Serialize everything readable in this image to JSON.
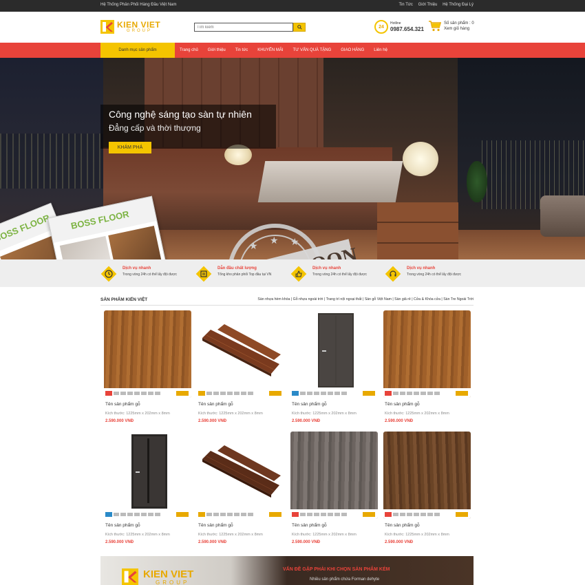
{
  "topbar": {
    "tagline": "Hệ Thống Phân Phối Hàng Đầu Việt Nam",
    "links": [
      "Tin Tức",
      "Giới Thiệu",
      "Hệ Thống Đại Lý"
    ]
  },
  "header": {
    "logo_text": "KIEN VIET",
    "logo_sub": "GROUP",
    "search_placeholder": "Tìm kiếm",
    "hotline_badge": "24",
    "hotline_label": "Hotline",
    "hotline_number": "0987.654.321",
    "cart_count": "Số sản phẩm : 0",
    "cart_view": "Xem giỏ hàng"
  },
  "nav": {
    "category": "Danh mục sản phẩm",
    "items": [
      "Trang chủ",
      "Giới thiệu",
      "Tin tức",
      "KHUYẾN MÃI",
      "TƯ VẤN QUÀ TẶNG",
      "GIAO HÀNG",
      "Liên hệ"
    ]
  },
  "banner": {
    "title": "Công nghệ sáng tạo sàn tự nhiên",
    "subtitle": "Đẳng cấp và thời thượng",
    "button": "KHÁM PHÁ",
    "catalog_brand": "BOSS FLOOR",
    "stamp_text": "COMING SOON"
  },
  "services": [
    {
      "title": "Dịch vụ nhanh",
      "desc": "Trong vòng 24h có thể lấy đội được"
    },
    {
      "title": "Dẫn đầu chất lượng",
      "desc": "Tổng kho phân phối Top đầu tại VN"
    },
    {
      "title": "Dịch vụ nhanh",
      "desc": "Trong vòng 24h có thể lấy đội được"
    },
    {
      "title": "Dịch vụ nhanh",
      "desc": "Trong vòng 24h có thể lấy đội được"
    }
  ],
  "products_section": {
    "title": "SẢN PHẨM KIẾN VIỆT",
    "tabs": "Sàn nhựa hèm khóa | Gỗ nhựa ngoài trời | Trang trí nội ngoại thất | Sàn gỗ Việt Nam | Sàn giả rẻ | Cửa & Khóa cửa | Sàn Tre Ngoài Trời"
  },
  "products": [
    {
      "name": "Tên sản phẩm gỗ",
      "size": "Kích thước: 1225mm x 202mm x 8mm",
      "price": "2.590.000 VNĐ"
    },
    {
      "name": "Tên sản phẩm gỗ",
      "size": "Kích thước: 1225mm x 202mm x 8mm",
      "price": "2.590.000 VNĐ"
    },
    {
      "name": "Tên sản phẩm gỗ",
      "size": "Kích thước: 1225mm x 202mm x 8mm",
      "price": "2.590.000 VNĐ"
    },
    {
      "name": "Tên sản phẩm gỗ",
      "size": "Kích thước: 1225mm x 202mm x 8mm",
      "price": "2.590.000 VNĐ"
    },
    {
      "name": "Tên sản phẩm gỗ",
      "size": "Kích thước: 1225mm x 202mm x 8mm",
      "price": "2.590.000 VNĐ"
    },
    {
      "name": "Tên sản phẩm gỗ",
      "size": "Kích thước: 1225mm x 202mm x 8mm",
      "price": "2.590.000 VNĐ"
    },
    {
      "name": "Tên sản phẩm gỗ",
      "size": "Kích thước: 1225mm x 202mm x 8mm",
      "price": "2.590.000 VNĐ"
    },
    {
      "name": "Tên sản phẩm gỗ",
      "size": "Kích thước: 1225mm x 202mm x 8mm",
      "price": "2.590.000 VNĐ"
    }
  ],
  "bottom_banner": {
    "logo_text": "KIEN VIET",
    "logo_sub": "GROUP",
    "title": "VẤN ĐỀ GẶP PHẢI KHI CHỌN SẢN PHẨM KÉM",
    "subtitle": "Nhiều sản phẩm chứa Forman dehyte"
  },
  "colors": {
    "accent_red": "#e8433a",
    "accent_yellow": "#f4c400",
    "topbar": "#2b2b2b"
  }
}
